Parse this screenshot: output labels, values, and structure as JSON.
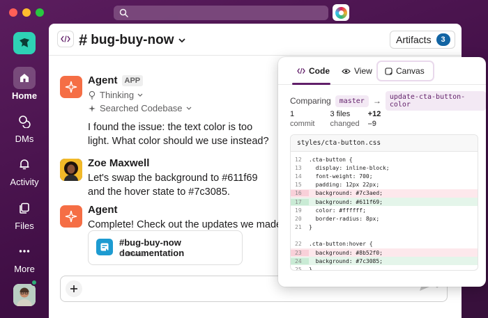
{
  "window": {
    "search_placeholder": ""
  },
  "rail": {
    "items": [
      {
        "label": "Home",
        "icon": "home-icon"
      },
      {
        "label": "DMs",
        "icon": "chat-bubbles-icon"
      },
      {
        "label": "Activity",
        "icon": "bell-icon"
      },
      {
        "label": "Files",
        "icon": "files-icon"
      },
      {
        "label": "More",
        "icon": "ellipsis-icon"
      }
    ]
  },
  "channel": {
    "name": "bug-buy-now",
    "artifacts_label": "Artifacts",
    "artifacts_count": "3"
  },
  "messages": [
    {
      "sender": "Agent",
      "tag": "APP",
      "thinking": "Thinking",
      "searched": "Searched Codebase",
      "text": "I found the issue: the text color is too light. What color should we use instead?"
    },
    {
      "sender": "Zoe Maxwell",
      "text": "Let's swap the background to #611f69 and the hover state to #7c3085."
    },
    {
      "sender": "Agent",
      "text": "Complete! Check out the updates we made:"
    }
  ],
  "doc_card": {
    "title": "#bug-buy-now documentation",
    "subtitle": "Canvas"
  },
  "panel": {
    "tabs": {
      "code": "Code",
      "view": "View",
      "canvas": "Canvas"
    },
    "comparing_label": "Comparing",
    "base_branch": "master",
    "arrow": "→",
    "head_branch": "update-cta-button-color",
    "stats": {
      "commits_value": "1",
      "commits_label": "commit",
      "files_value": "3 files",
      "files_label": "changed",
      "additions": "+12",
      "deletions": "–9"
    },
    "file_name": "styles/cta-button.css",
    "lines": [
      {
        "num": "12",
        "text": ".cta-button {",
        "type": "ctx"
      },
      {
        "num": "13",
        "text": "  display: inline-block;",
        "type": "ctx"
      },
      {
        "num": "14",
        "text": "  font-weight: 700;",
        "type": "ctx"
      },
      {
        "num": "15",
        "text": "  padding: 12px 22px;",
        "type": "ctx"
      },
      {
        "num": "16",
        "text": "  background: #7c3aed;",
        "type": "del"
      },
      {
        "num": "17",
        "text": "  background: #611f69;",
        "type": "add"
      },
      {
        "num": "19",
        "text": "  color: #ffffff;",
        "type": "ctx"
      },
      {
        "num": "20",
        "text": "  border-radius: 8px;",
        "type": "ctx"
      },
      {
        "num": "21",
        "text": "}",
        "type": "ctx"
      },
      {
        "num": "",
        "text": "",
        "type": "ctx"
      },
      {
        "num": "22",
        "text": ".cta-button:hover {",
        "type": "ctx"
      },
      {
        "num": "23",
        "text": "  background: #8b52f0;",
        "type": "del"
      },
      {
        "num": "24",
        "text": "  background: #7c3085;",
        "type": "add"
      },
      {
        "num": "25",
        "text": "}",
        "type": "ctx"
      }
    ]
  },
  "colors": {
    "sidebar": "#3f0e44",
    "accent": "#611f69",
    "badge": "#1264a3",
    "agent_avatar": "#f56e45",
    "workspace_logo": "#2ed1b5"
  }
}
